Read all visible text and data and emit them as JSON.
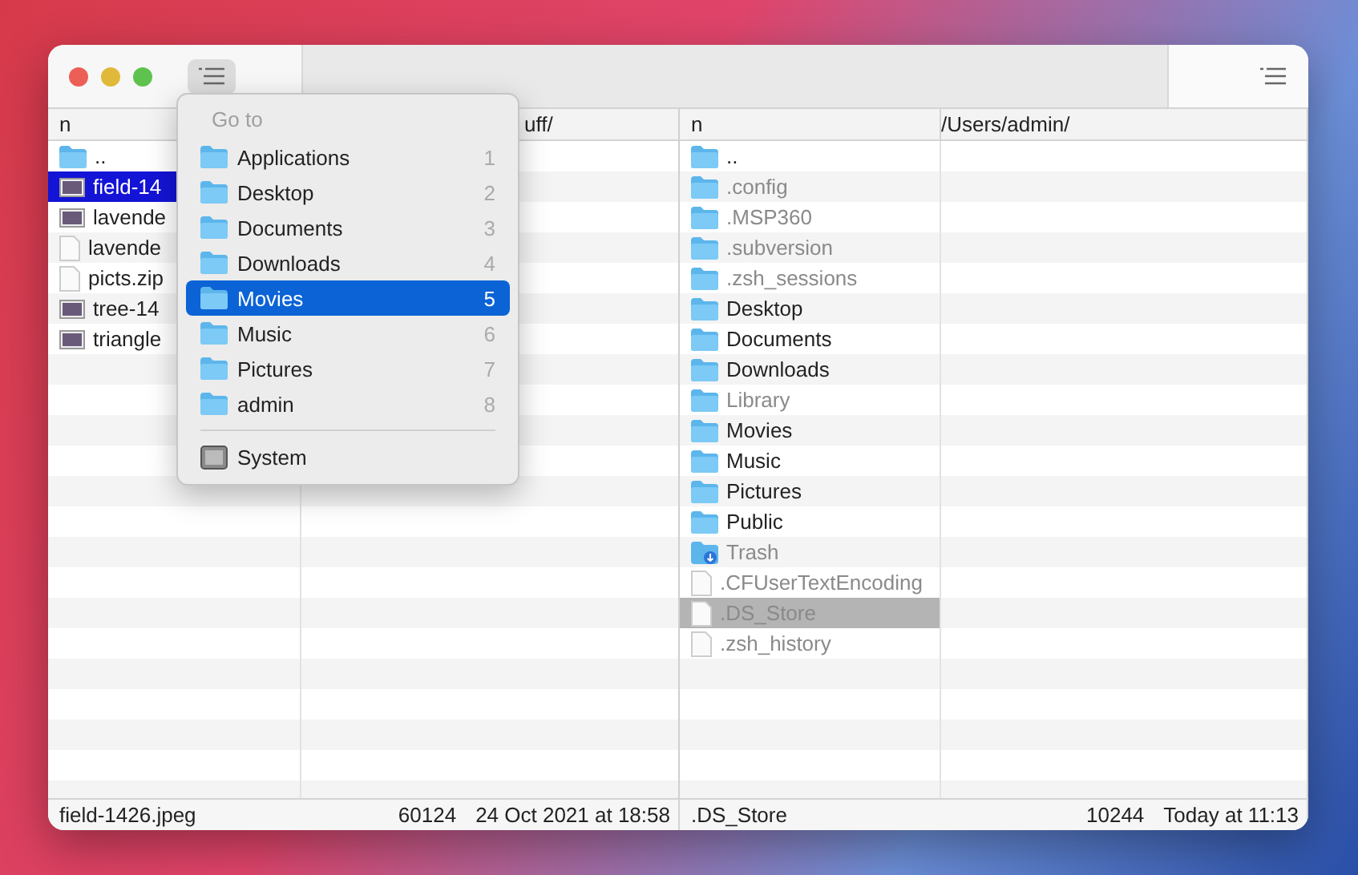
{
  "left_pane": {
    "columns": [
      "n",
      "uff/"
    ],
    "rows": [
      {
        "name": "..",
        "kind": "folder",
        "selected": false,
        "hidden": false
      },
      {
        "name": "field-14",
        "kind": "image",
        "selected": true,
        "hidden": false
      },
      {
        "name": "lavende",
        "kind": "image",
        "selected": false,
        "hidden": false
      },
      {
        "name": "lavende",
        "kind": "file",
        "selected": false,
        "hidden": false
      },
      {
        "name": "picts.zip",
        "kind": "file",
        "selected": false,
        "hidden": false
      },
      {
        "name": "tree-14",
        "kind": "image",
        "selected": false,
        "hidden": false
      },
      {
        "name": "triangle",
        "kind": "image",
        "selected": false,
        "hidden": false
      }
    ]
  },
  "right_pane": {
    "columns": [
      "n",
      "/Users/admin/"
    ],
    "rows": [
      {
        "name": "..",
        "kind": "folder",
        "selected": false,
        "hidden": false
      },
      {
        "name": ".config",
        "kind": "folder",
        "selected": false,
        "hidden": true
      },
      {
        "name": ".MSP360",
        "kind": "folder",
        "selected": false,
        "hidden": true
      },
      {
        "name": ".subversion",
        "kind": "folder",
        "selected": false,
        "hidden": true
      },
      {
        "name": ".zsh_sessions",
        "kind": "folder",
        "selected": false,
        "hidden": true
      },
      {
        "name": "Desktop",
        "kind": "folder",
        "selected": false,
        "hidden": false
      },
      {
        "name": "Documents",
        "kind": "folder",
        "selected": false,
        "hidden": false
      },
      {
        "name": "Downloads",
        "kind": "folder",
        "selected": false,
        "hidden": false
      },
      {
        "name": "Library",
        "kind": "folder",
        "selected": false,
        "hidden": true
      },
      {
        "name": "Movies",
        "kind": "folder",
        "selected": false,
        "hidden": false
      },
      {
        "name": "Music",
        "kind": "folder",
        "selected": false,
        "hidden": false
      },
      {
        "name": "Pictures",
        "kind": "folder",
        "selected": false,
        "hidden": false
      },
      {
        "name": "Public",
        "kind": "folder",
        "selected": false,
        "hidden": false
      },
      {
        "name": "Trash",
        "kind": "trash",
        "selected": false,
        "hidden": true
      },
      {
        "name": ".CFUserTextEncoding",
        "kind": "file",
        "selected": false,
        "hidden": true
      },
      {
        "name": ".DS_Store",
        "kind": "file",
        "selected": true,
        "hidden": true
      },
      {
        "name": ".zsh_history",
        "kind": "file",
        "selected": false,
        "hidden": true
      }
    ]
  },
  "goto_menu": {
    "title": "Go to",
    "items": [
      {
        "label": "Applications",
        "shortcut": "1",
        "kind": "folder",
        "selected": false
      },
      {
        "label": "Desktop",
        "shortcut": "2",
        "kind": "folder",
        "selected": false
      },
      {
        "label": "Documents",
        "shortcut": "3",
        "kind": "folder",
        "selected": false
      },
      {
        "label": "Downloads",
        "shortcut": "4",
        "kind": "folder",
        "selected": false
      },
      {
        "label": "Movies",
        "shortcut": "5",
        "kind": "folder",
        "selected": true
      },
      {
        "label": "Music",
        "shortcut": "6",
        "kind": "folder",
        "selected": false
      },
      {
        "label": "Pictures",
        "shortcut": "7",
        "kind": "folder",
        "selected": false
      },
      {
        "label": "admin",
        "shortcut": "8",
        "kind": "folder",
        "selected": false
      },
      {
        "label": "System",
        "kind": "disk",
        "selected": false
      }
    ]
  },
  "status_bar": {
    "left": {
      "name": "field-1426.jpeg",
      "size": "60124",
      "date": "24 Oct 2021 at 18:58"
    },
    "right": {
      "name": ".DS_Store",
      "size": "10244",
      "date": "Today at 11:13"
    }
  }
}
